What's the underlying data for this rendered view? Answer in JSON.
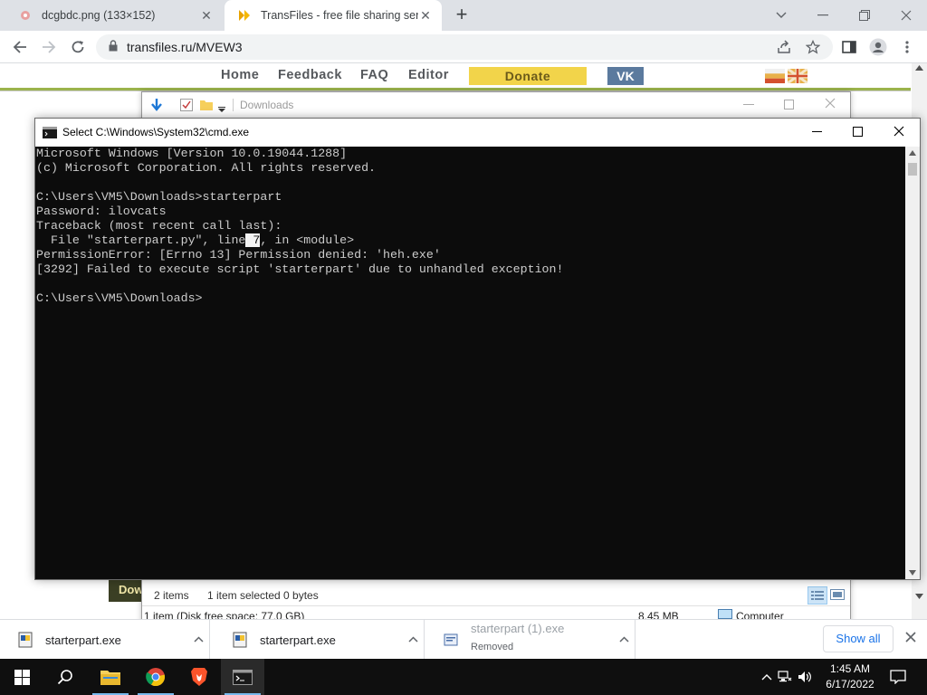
{
  "browser": {
    "tabs": [
      {
        "title": "dcgbdc.png (133×152)",
        "active": false
      },
      {
        "title": "TransFiles - free file sharing servi",
        "active": true
      }
    ],
    "url": "transfiles.ru/MVEW3"
  },
  "site": {
    "nav": [
      "Home",
      "Feedback",
      "FAQ",
      "Editor"
    ],
    "donate": "Donate",
    "vk": "VK",
    "download_button": "Dow"
  },
  "explorer": {
    "title": "Downloads",
    "status": {
      "items": "2 items",
      "selected": "1 item selected  0 bytes"
    },
    "info": {
      "free_space": "1 item (Disk free space: 77.0 GB)",
      "size": "8.45 MB",
      "location": "Computer"
    }
  },
  "cmd": {
    "title": "Select C:\\Windows\\System32\\cmd.exe",
    "lines": {
      "l1": "Microsoft Windows [Version 10.0.19044.1288]",
      "l2": "(c) Microsoft Corporation. All rights reserved.",
      "l3": "",
      "l4": "C:\\Users\\VM5\\Downloads>starterpart",
      "l5": "Password: ilovcats",
      "l6": "Traceback (most recent call last):",
      "l7a": "  File \"starterpart.py\", line",
      "l7sel": " 7",
      "l7b": ", in <module>",
      "l8": "PermissionError: [Errno 13] Permission denied: 'heh.exe'",
      "l9": "[3292] Failed to execute script 'starterpart' due to unhandled exception!",
      "l10": "",
      "l11": "C:\\Users\\VM5\\Downloads>"
    }
  },
  "downloads": {
    "items": [
      {
        "name": "starterpart.exe",
        "sub": ""
      },
      {
        "name": "starterpart.exe",
        "sub": ""
      },
      {
        "name": "starterpart (1).exe",
        "sub": "Removed"
      }
    ],
    "show_all": "Show all"
  },
  "taskbar": {
    "time": "1:45 AM",
    "date": "6/17/2022"
  },
  "colors": {
    "donate": "#f2d44a",
    "vk": "#5b7a9e",
    "accent_green": "#9bb34c",
    "console_bg": "#0c0c0c",
    "console_fg": "#cccccc",
    "link_blue": "#1a73e8"
  }
}
